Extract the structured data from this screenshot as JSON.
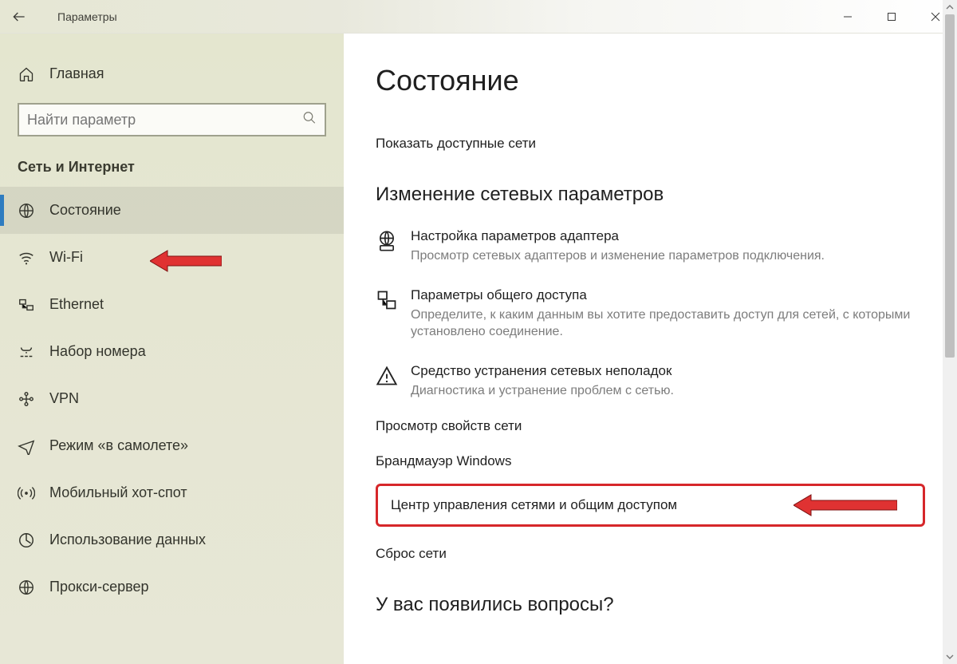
{
  "titlebar": {
    "title": "Параметры"
  },
  "home_label": "Главная",
  "search": {
    "placeholder": "Найти параметр"
  },
  "section_label": "Сеть и Интернет",
  "nav": [
    {
      "label": "Состояние"
    },
    {
      "label": "Wi-Fi"
    },
    {
      "label": "Ethernet"
    },
    {
      "label": "Набор номера"
    },
    {
      "label": "VPN"
    },
    {
      "label": "Режим «в самолете»"
    },
    {
      "label": "Мобильный хот-спот"
    },
    {
      "label": "Использование данных"
    },
    {
      "label": "Прокси-сервер"
    }
  ],
  "main": {
    "heading": "Состояние",
    "show_networks": "Показать доступные сети",
    "subheading": "Изменение сетевых параметров",
    "options": [
      {
        "title": "Настройка параметров адаптера",
        "desc": "Просмотр сетевых адаптеров и изменение параметров подключения."
      },
      {
        "title": "Параметры общего доступа",
        "desc": "Определите, к каким данным вы хотите предоставить доступ для сетей, с которыми установлено соединение."
      },
      {
        "title": "Средство устранения сетевых неполадок",
        "desc": "Диагностика и устранение проблем с сетью."
      }
    ],
    "links": {
      "view_props": "Просмотр свойств сети",
      "firewall": "Брандмауэр Windows",
      "sharing_center": "Центр управления сетями и общим доступом",
      "reset": "Сброс сети"
    },
    "bottom_heading": "У вас появились вопросы?"
  }
}
